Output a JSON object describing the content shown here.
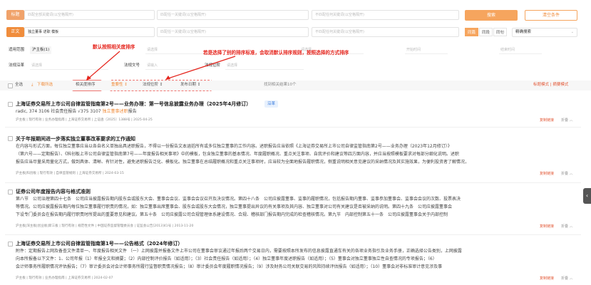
{
  "search": {
    "rows": [
      {
        "label": "标题",
        "inputs": [
          "匹配全部关键词(以空格隔开)",
          "匹配任一关键词(以空格隔开)",
          "不匹配任何关键词(以空格隔开)"
        ]
      },
      {
        "label": "正文",
        "inputs": [
          "独立董事 述职 模板",
          "匹配任一关键词(以空格隔开)",
          "不匹配任何关键词(以空格隔开)"
        ]
      }
    ],
    "search_button": "搜索",
    "clear_button": "清空条件",
    "scope_segments": [
      "同篇",
      "同段",
      "同句"
    ],
    "scope_active": 0,
    "sort_select": "精确搜索"
  },
  "filters": {
    "row1": [
      {
        "label": "适用范围",
        "value": "沪主板(1)"
      },
      {
        "label": "",
        "value": "请选择"
      },
      {
        "label": "",
        "value": "请选择"
      },
      {
        "label": "",
        "value": "开始时间"
      },
      {
        "label": "",
        "value": "结束时间"
      }
    ],
    "row2": [
      {
        "label": "法规沿革",
        "value": "请选择"
      },
      {
        "label": "法规文号",
        "value": "请输入"
      },
      {
        "label": "法规位阶",
        "value": "请选择"
      }
    ]
  },
  "annotations": {
    "a1": "默认按照相关度排序",
    "a2": "若是选择了别的排序标准，会取消默认排序规则，按照选择的方式排序"
  },
  "toolbar": {
    "select_all": "全选",
    "download": "下载所选",
    "sort_relevance": "相关度排序",
    "sort_options": [
      "重要性 ↕",
      "法规位阶 ↕",
      "发布日期 ↕"
    ],
    "result_count": "找到相关结果10个",
    "view_modes": "标题模式 | 摘要模式"
  },
  "results": [
    {
      "title": "上海证券交易所上市公司自律监管指南第2号——业务办理：第一号信息披露业务办理（2025年4月修订）",
      "badge": "沿革",
      "text_a": "radic, 374 3106 社会责任报告 √375 3107 ",
      "text_hl": "独立董事述职",
      "text_b": "报告",
      "meta": "沪主板 | 现行有效 | 业务办理指南 | 上海证券交易所 | 上证函〔2025〕1388号 | 2025-04-25",
      "action": "复制链接",
      "fold": "折叠 ︿"
    },
    {
      "title": "关于年报期间进一步落实独立董事改革要求的工作通知",
      "line1": "在内容与形式方面，每位独立董事应当以各自名义单独出具述职报告，不得以一份报告文本涵括所有或多位独立董事的工作内容。述职报告应当依照《上海证券交易所上市公司自律监管指南第2号——业务办理（2023年12月修订）》",
      "line2": "（第六号——定期报告）、《科创板上市公司自律监管指南第7号——年度报告相关事项》中的模板，包含独立董事的基本情况、年度履职概况、重点关注事项、自我评价和建议等四方面内容，并应当按照模板要求对每部分细化说明。述职",
      "line3": "报告应当尽量采用量化方式，做到具体、清晰、有针对性，避免述职报告泛化、模板化。独立董事在总结履职概况和重点关注事项时，应当较为全面地报告履职情况，侧重说明相关意见建议的采纳情况及其实施效果，为便利投资者了解情况，",
      "meta": "沪主板|科创板 | 现行有效 | 自律监管规则 | 上海证券交易所 | 2024-03-15",
      "action": "复制链接",
      "fold": "折叠 ︿"
    },
    {
      "title": "证券公司年度报告内容与格式准则",
      "line1": "第八节　公司治理第四十七条　公司应当披露报告期内股东会或股东大会、董事会会议、监事会会议召开及决议情况。第四十八条　公司应披露董事、监事的履职情况，包括报告期内董事、监事参加董事会、监事会会议的次数、投票表决",
      "line2": "等情况。公司应披露报告期内每位独立董事履行职责的情况，如：独立董事出席董事会、股东会或股东大会情况，独立董事提出异议的有关事项及其内容、独立董事对公司有关建议是否被采纳的说明。第四十九条　公司应披露董事会",
      "line3": "下设专门委员会在报告期内履行职责时所提出的重要意见和建议。第五十条　公司应披露公司合规管理体系建设情况、合规、稽核部门报告期内完成的检查稽核情况。第九节　内部控制第五十一条　公司应披露董事会关于内部控制",
      "meta": "沪主板|深主板|创业板|新三板 | 现行有效 | 规范性文件 | 中国证券监督管理委员会 | 证监会公告[2013]41号 | 2013-11-20",
      "action": "复制链接",
      "fold": "折叠 ︿"
    },
    {
      "title": "上海证券交易所上市公司自律监管指南第1号——公告格式（2024年修订）",
      "line1": "附件：定期报告上网及备查文件清单一、年度报告相关文件 （一）上网披露并报备文件上市公司在董事会审议通过年报后两个交易日内，需要按照本所发布的信息披露直通车有关的各项业务指引及业务手册，正确选择公告类别，上网披露",
      "line2": "向本所报备以下文件：1、公司年报（1）年报全文和摘要；（2）内部控制评价报告（如适用）；（3）社会责任报告（如适用）；（4）独立董事年度述职报告（如适用）；（5）董事会对独立董事独立性自查情况的专项报告；（6）",
      "line3": "会计师事务所履职情况评估报告；（7）审计委员会对会计师事务所履行监督职责情况报告；（8）审计委员会年度履职情况报告；（9）涉及财务公司关联交易的风险持续评估报告（如适用）；（10）董事会对非标准审计意见涉及事",
      "meta": "沪主板 | 现行有效 | 业务办理指南 | 上海证券交易所 | 2024-02-07",
      "action": "复制链接",
      "fold": "折叠 ︿"
    }
  ],
  "colors": {
    "accent": "#f6a55e",
    "annotation": "#e5231b",
    "highlight": "#f08d3c"
  }
}
